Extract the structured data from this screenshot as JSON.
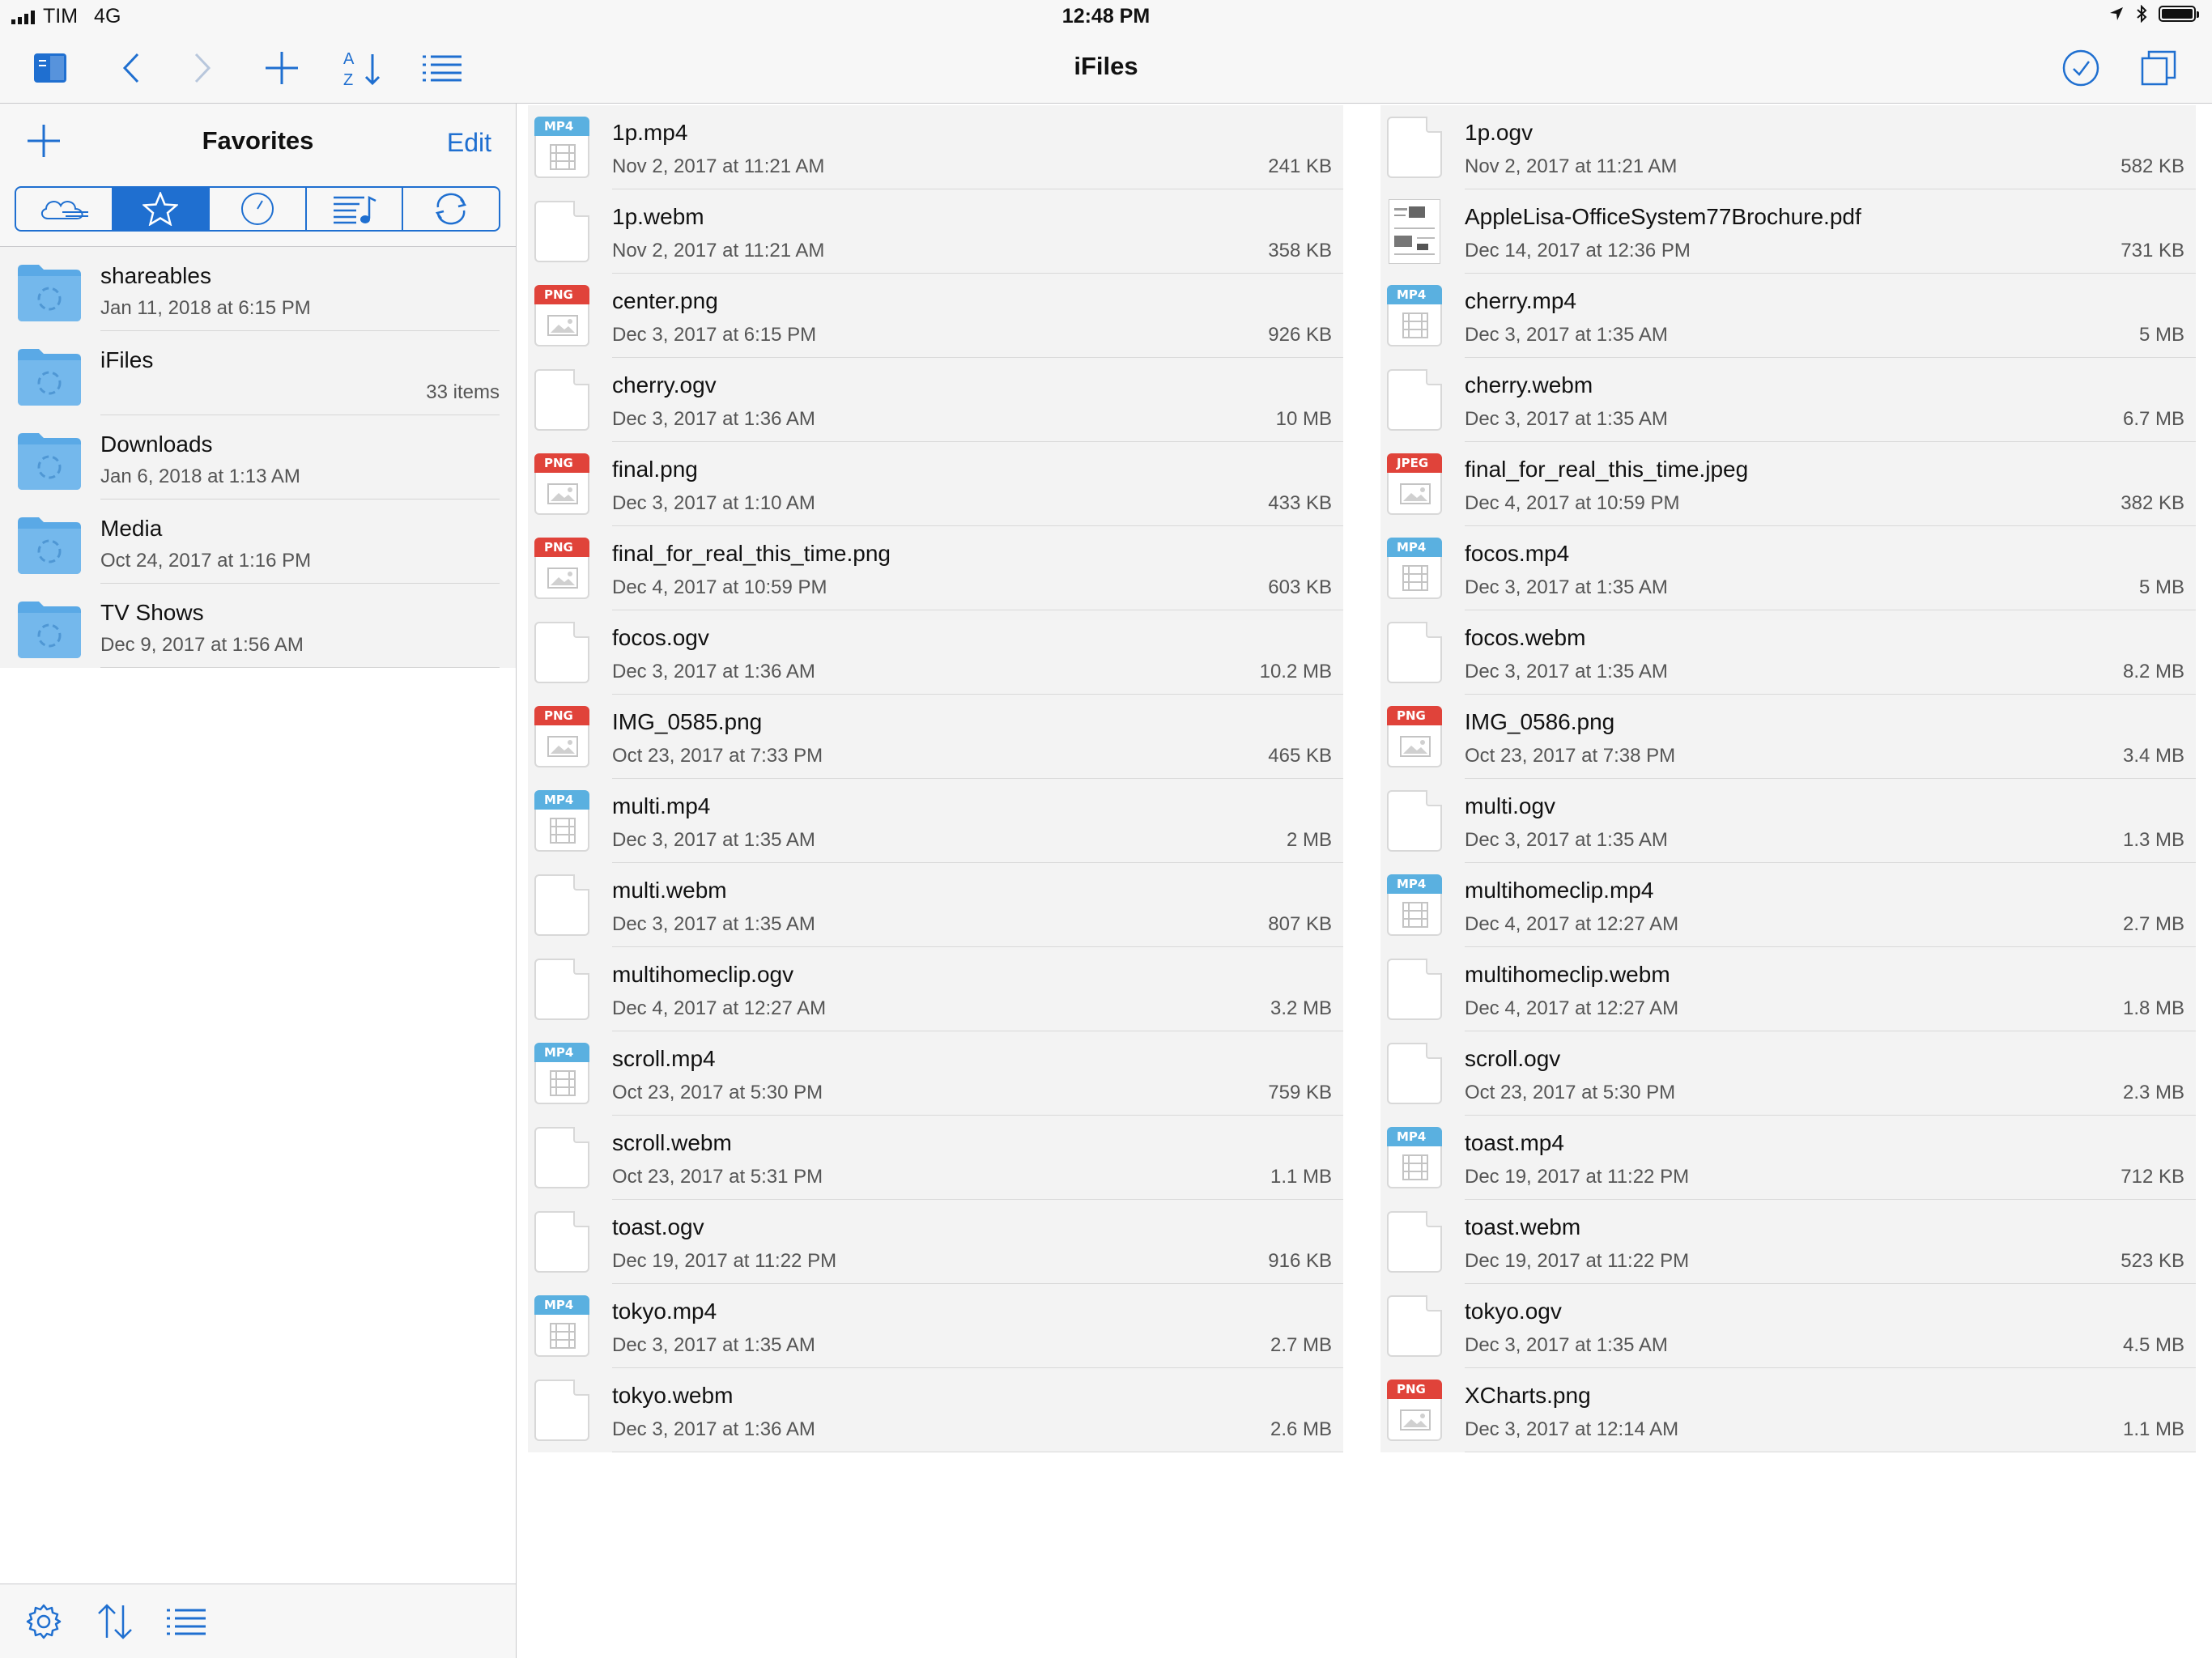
{
  "status_bar": {
    "carrier": "TIM",
    "network": "4G",
    "time": "12:48 PM"
  },
  "toolbar": {
    "title": "iFiles",
    "sort_label_top": "A",
    "sort_label_bottom": "Z"
  },
  "sidebar": {
    "title": "Favorites",
    "edit_label": "Edit",
    "segments": [
      "cloud-icon",
      "star-icon",
      "clock-icon",
      "music-list-icon",
      "sync-icon"
    ],
    "active_segment": 1,
    "items": [
      {
        "name": "shareables",
        "subtitle": "Jan 11, 2018 at 6:15 PM",
        "count": ""
      },
      {
        "name": "iFiles",
        "subtitle": "",
        "count": "33 items"
      },
      {
        "name": "Downloads",
        "subtitle": "Jan 6, 2018 at 1:13 AM",
        "count": ""
      },
      {
        "name": "Media",
        "subtitle": "Oct 24, 2017 at 1:16 PM",
        "count": ""
      },
      {
        "name": "TV Shows",
        "subtitle": "Dec 9, 2017 at 1:56 AM",
        "count": ""
      }
    ]
  },
  "colors": {
    "accent": "#1f6fd0",
    "folder": "#5aa9e6",
    "mp4_badge": "#5ab0e0",
    "png_badge": "#e0433a"
  },
  "files": [
    {
      "name": "1p.mp4",
      "date": "Nov 2, 2017 at 11:21 AM",
      "size": "241 KB",
      "type": "MP4"
    },
    {
      "name": "1p.ogv",
      "date": "Nov 2, 2017 at 11:21 AM",
      "size": "582 KB",
      "type": ""
    },
    {
      "name": "1p.webm",
      "date": "Nov 2, 2017 at 11:21 AM",
      "size": "358 KB",
      "type": ""
    },
    {
      "name": "AppleLisa-OfficeSystem77Brochure.pdf",
      "date": "Dec 14, 2017 at 12:36 PM",
      "size": "731 KB",
      "type": "PDF"
    },
    {
      "name": "center.png",
      "date": "Dec 3, 2017 at 6:15 PM",
      "size": "926 KB",
      "type": "PNG"
    },
    {
      "name": "cherry.mp4",
      "date": "Dec 3, 2017 at 1:35 AM",
      "size": "5 MB",
      "type": "MP4"
    },
    {
      "name": "cherry.ogv",
      "date": "Dec 3, 2017 at 1:36 AM",
      "size": "10 MB",
      "type": ""
    },
    {
      "name": "cherry.webm",
      "date": "Dec 3, 2017 at 1:35 AM",
      "size": "6.7 MB",
      "type": ""
    },
    {
      "name": "final.png",
      "date": "Dec 3, 2017 at 1:10 AM",
      "size": "433 KB",
      "type": "PNG"
    },
    {
      "name": "final_for_real_this_time.jpeg",
      "date": "Dec 4, 2017 at 10:59 PM",
      "size": "382 KB",
      "type": "JPEG"
    },
    {
      "name": "final_for_real_this_time.png",
      "date": "Dec 4, 2017 at 10:59 PM",
      "size": "603 KB",
      "type": "PNG"
    },
    {
      "name": "focos.mp4",
      "date": "Dec 3, 2017 at 1:35 AM",
      "size": "5 MB",
      "type": "MP4"
    },
    {
      "name": "focos.ogv",
      "date": "Dec 3, 2017 at 1:36 AM",
      "size": "10.2 MB",
      "type": ""
    },
    {
      "name": "focos.webm",
      "date": "Dec 3, 2017 at 1:35 AM",
      "size": "8.2 MB",
      "type": ""
    },
    {
      "name": "IMG_0585.png",
      "date": "Oct 23, 2017 at 7:33 PM",
      "size": "465 KB",
      "type": "PNG"
    },
    {
      "name": "IMG_0586.png",
      "date": "Oct 23, 2017 at 7:38 PM",
      "size": "3.4 MB",
      "type": "PNG"
    },
    {
      "name": "multi.mp4",
      "date": "Dec 3, 2017 at 1:35 AM",
      "size": "2 MB",
      "type": "MP4"
    },
    {
      "name": "multi.ogv",
      "date": "Dec 3, 2017 at 1:35 AM",
      "size": "1.3 MB",
      "type": ""
    },
    {
      "name": "multi.webm",
      "date": "Dec 3, 2017 at 1:35 AM",
      "size": "807 KB",
      "type": ""
    },
    {
      "name": "multihomeclip.mp4",
      "date": "Dec 4, 2017 at 12:27 AM",
      "size": "2.7 MB",
      "type": "MP4"
    },
    {
      "name": "multihomeclip.ogv",
      "date": "Dec 4, 2017 at 12:27 AM",
      "size": "3.2 MB",
      "type": ""
    },
    {
      "name": "multihomeclip.webm",
      "date": "Dec 4, 2017 at 12:27 AM",
      "size": "1.8 MB",
      "type": ""
    },
    {
      "name": "scroll.mp4",
      "date": "Oct 23, 2017 at 5:30 PM",
      "size": "759 KB",
      "type": "MP4"
    },
    {
      "name": "scroll.ogv",
      "date": "Oct 23, 2017 at 5:30 PM",
      "size": "2.3 MB",
      "type": ""
    },
    {
      "name": "scroll.webm",
      "date": "Oct 23, 2017 at 5:31 PM",
      "size": "1.1 MB",
      "type": ""
    },
    {
      "name": "toast.mp4",
      "date": "Dec 19, 2017 at 11:22 PM",
      "size": "712 KB",
      "type": "MP4"
    },
    {
      "name": "toast.ogv",
      "date": "Dec 19, 2017 at 11:22 PM",
      "size": "916 KB",
      "type": ""
    },
    {
      "name": "toast.webm",
      "date": "Dec 19, 2017 at 11:22 PM",
      "size": "523 KB",
      "type": ""
    },
    {
      "name": "tokyo.mp4",
      "date": "Dec 3, 2017 at 1:35 AM",
      "size": "2.7 MB",
      "type": "MP4"
    },
    {
      "name": "tokyo.ogv",
      "date": "Dec 3, 2017 at 1:35 AM",
      "size": "4.5 MB",
      "type": ""
    },
    {
      "name": "tokyo.webm",
      "date": "Dec 3, 2017 at 1:36 AM",
      "size": "2.6 MB",
      "type": ""
    },
    {
      "name": "XCharts.png",
      "date": "Dec 3, 2017 at 12:14 AM",
      "size": "1.1 MB",
      "type": "PNG"
    }
  ]
}
